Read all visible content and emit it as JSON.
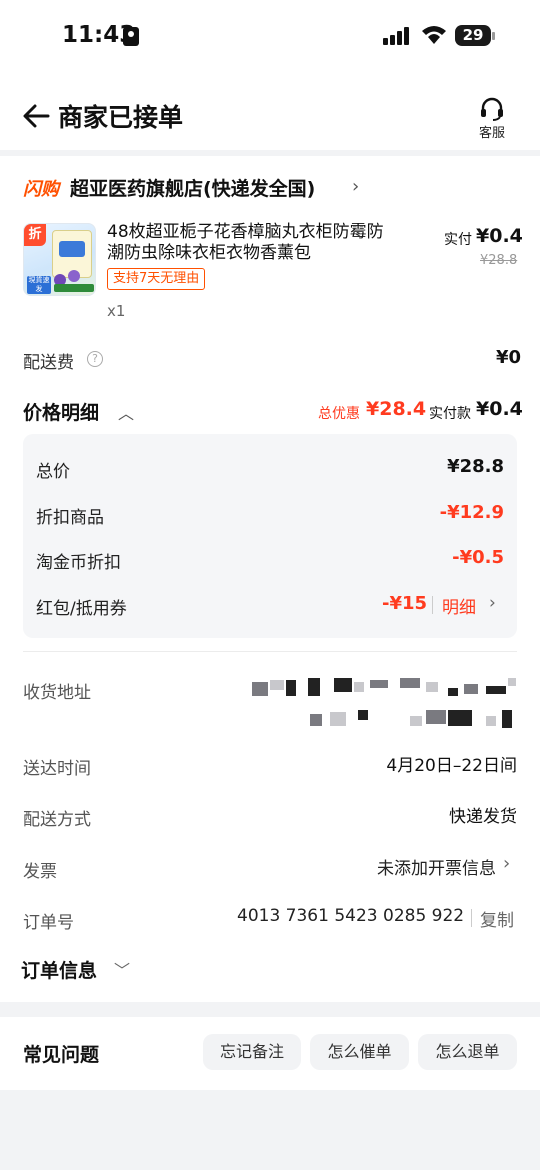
{
  "status_bar": {
    "time": "11:43",
    "battery": "29"
  },
  "header": {
    "title": "商家已接单",
    "service_label": "客服"
  },
  "shop": {
    "tag": "闪购",
    "name": "超亚医药旗舰店(快递发全国)"
  },
  "product": {
    "title": "48枚超亚栀子花香樟脑丸衣柜防霉防潮防虫除味衣柜衣物香薰包",
    "return_tag": "支持7天无理由",
    "quantity": "x1",
    "paid_label": "实付",
    "paid_price": "¥0.4",
    "original_price": "¥28.8",
    "thumb_badge": "折",
    "thumb_corner": "現貨速发"
  },
  "shipping_fee": {
    "label": "配送费",
    "value": "¥0"
  },
  "price_detail": {
    "title": "价格明细",
    "discount_label": "总优惠",
    "discount_value": "¥28.4",
    "actual_label": "实付款",
    "actual_value": "¥0.4",
    "rows": [
      {
        "label": "总价",
        "value": "¥28.8"
      },
      {
        "label": "折扣商品",
        "value": "-¥12.9"
      },
      {
        "label": "淘金币折扣",
        "value": "-¥0.5"
      },
      {
        "label": "红包/抵用券",
        "value": "-¥15",
        "link": "明细"
      }
    ]
  },
  "order_fields": {
    "address_label": "收货地址",
    "delivery_time_label": "送达时间",
    "delivery_time_value": "4月20日–22日间",
    "shipping_method_label": "配送方式",
    "shipping_method_value": "快递发货",
    "invoice_label": "发票",
    "invoice_value": "未添加开票信息",
    "order_no_label": "订单号",
    "order_no_value": "4013 7361 5423 0285 922",
    "copy_label": "复制"
  },
  "order_info": {
    "title": "订单信息"
  },
  "faq": {
    "title": "常见问题",
    "chips": [
      "忘记备注",
      "怎么催单",
      "怎么退单"
    ]
  },
  "colors": {
    "accent": "#ff5000",
    "price_red": "#ff3b1f",
    "background": "#f2f3f5"
  }
}
